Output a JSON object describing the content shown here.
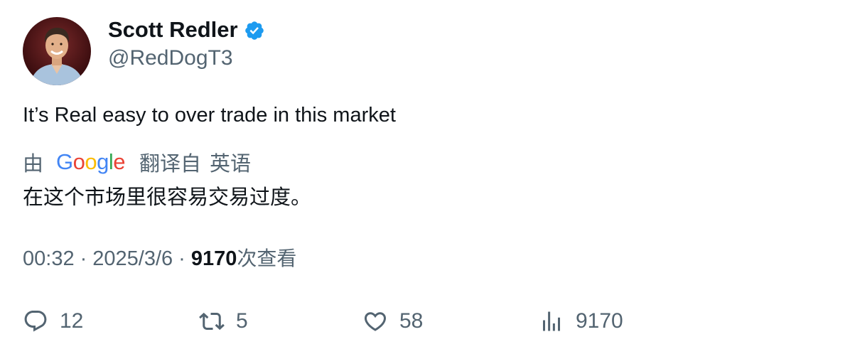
{
  "author": {
    "display_name": "Scott Redler",
    "handle": "@RedDogT3",
    "verified_color": "#1d9bf0"
  },
  "tweet": {
    "text": "It’s Real easy to over trade in this market"
  },
  "translation": {
    "prefix": "由",
    "provider_logo": [
      "G",
      "o",
      "o",
      "g",
      "l",
      "e"
    ],
    "label": "翻译自",
    "source_language": "英语",
    "translated_text": "在这个市场里很容易交易过度。"
  },
  "meta": {
    "time": "00:32",
    "separator": "·",
    "date": "2025/3/6",
    "views_count": "9170",
    "views_label": "次查看"
  },
  "actions": {
    "replies": "12",
    "retweets": "5",
    "likes": "58",
    "views": "9170"
  },
  "colors": {
    "text_primary": "#0f1419",
    "text_secondary": "#536471",
    "google_blue": "#4285F4",
    "google_red": "#EA4335",
    "google_yellow": "#FBBC05",
    "google_green": "#34A853"
  }
}
